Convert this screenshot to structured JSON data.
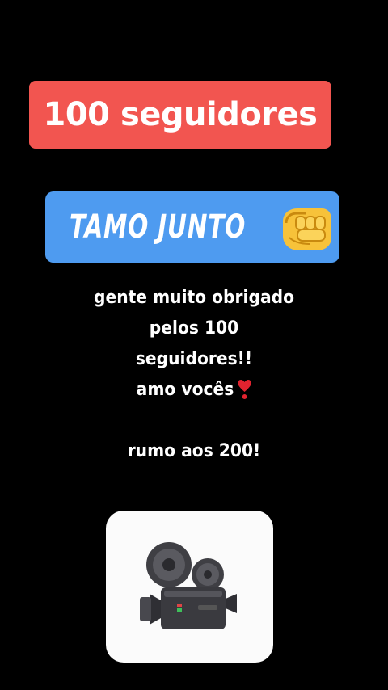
{
  "sticker_followers": {
    "text": "100 seguidores",
    "background_color": "#f25550"
  },
  "sticker_together": {
    "text": "TAMO JUNTO",
    "icon": "oncoming-fist-icon",
    "background_color": "#4e9bf0"
  },
  "caption": {
    "line1": "gente muito obrigado",
    "line2": "pelos 100",
    "line3": "seguidores!!",
    "line4": "amo vocês",
    "line4_icon": "heart-exclamation-icon",
    "line6": "rumo aos 200!"
  },
  "camera_sticker": {
    "icon": "movie-camera-icon"
  }
}
